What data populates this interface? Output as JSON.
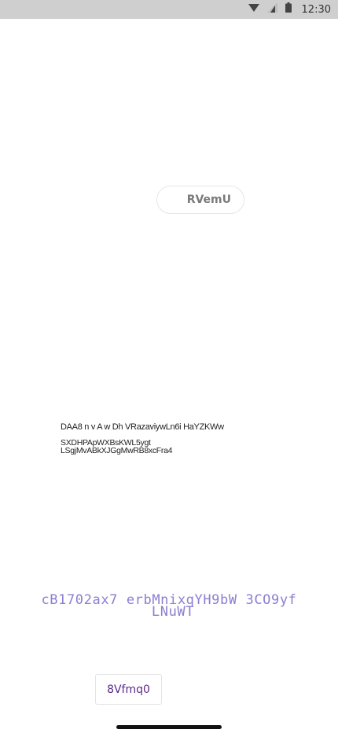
{
  "status_bar": {
    "time": "12:30",
    "icons": [
      "wifi-icon",
      "signal-icon",
      "battery-icon"
    ]
  },
  "pill_button": {
    "label": "RVemU"
  },
  "text_block": {
    "line1": "DAA8 n v A w Dh VRazaviywLn6i HaYZKWw",
    "line2": "SXDHPApWXBsKWL5ygt",
    "line3": "LSgjMvABkXJGgMwRB8xcFra4"
  },
  "purple_text": {
    "line1": "cB1702ax7  erbMnixqYH9bW 3CO9yf",
    "line2": "LNuWT"
  },
  "small_button": {
    "label": "8Vfmq0"
  },
  "colors": {
    "status_bar_bg": "#cfcfcf",
    "purple_text": "#8a7fd1",
    "button_text": "#5a2a8a"
  }
}
